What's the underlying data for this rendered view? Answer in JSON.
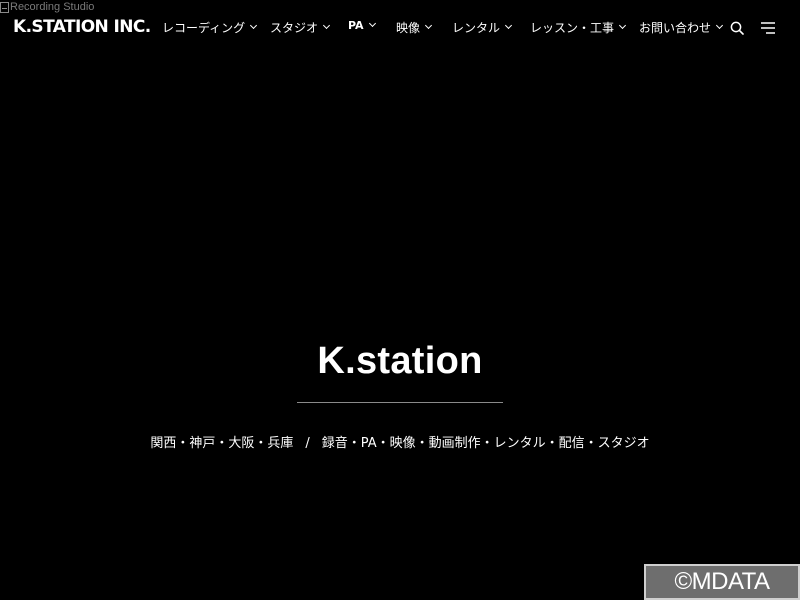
{
  "broken_image_alt": "Recording Studio",
  "header": {
    "logo": "K.STATION INC.",
    "nav": [
      {
        "label": "レコーディング"
      },
      {
        "label": "スタジオ"
      },
      {
        "label": "PA"
      },
      {
        "label": "映像"
      },
      {
        "label": "レンタル"
      },
      {
        "label": "レッスン・工事"
      },
      {
        "label": "お問い合わせ"
      }
    ],
    "icons": [
      "search-icon",
      "menu-icon"
    ]
  },
  "hero": {
    "title": "K.station",
    "subtitle_area": "関西・神戸・大阪・兵庫",
    "subtitle_separator": "/",
    "subtitle_services": "録音・PA・映像・動画制作・レンタル・配信・スタジオ"
  },
  "watermark": "©MDATA",
  "colors": {
    "background": "#000000",
    "text": "#ffffff",
    "divider": "#8a8a8a",
    "watermark_bg": "#6e6e6e"
  }
}
